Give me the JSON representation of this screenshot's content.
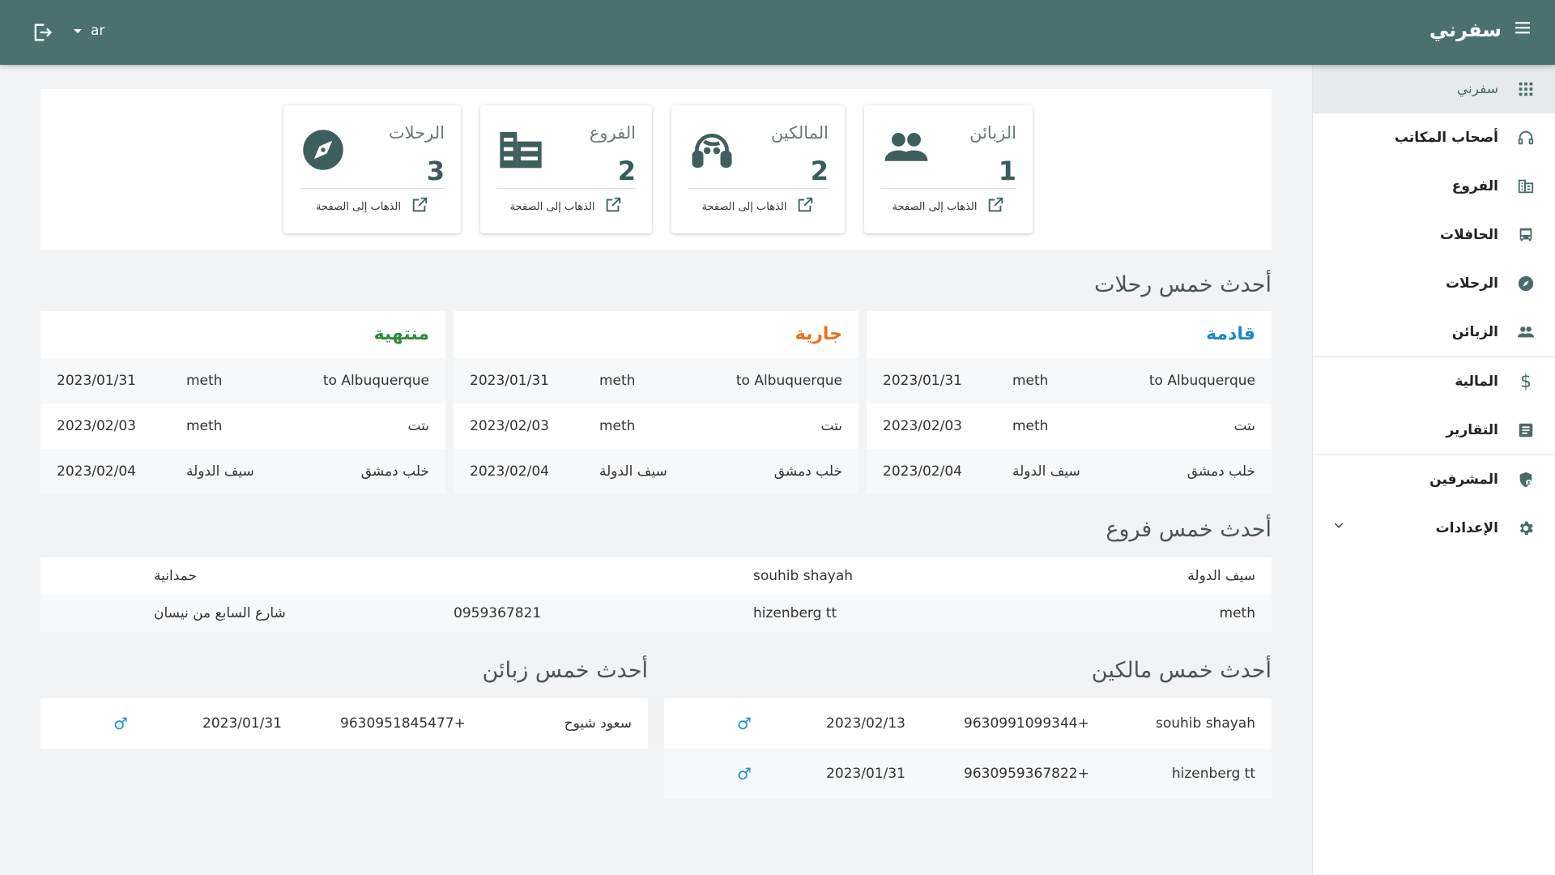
{
  "header": {
    "brand": "سفرني",
    "lang": "ar"
  },
  "sidebar": {
    "items": [
      {
        "label": "سفرني"
      },
      {
        "label": "أصحاب المكاتب"
      },
      {
        "label": "الفروع"
      },
      {
        "label": "الحافلات"
      },
      {
        "label": "الرحلات"
      },
      {
        "label": "الزبائن"
      },
      {
        "label": "المالية"
      },
      {
        "label": "التقارير"
      },
      {
        "label": "المشرفين"
      },
      {
        "label": "الإعدادات"
      }
    ]
  },
  "stats": [
    {
      "label": "الزبائن",
      "value": "1",
      "link": "الذهاب إلى الصفحة",
      "icon": "people-icon"
    },
    {
      "label": "المالكين",
      "value": "2",
      "link": "الذهاب إلى الصفحة",
      "icon": "headset-icon"
    },
    {
      "label": "الفروع",
      "value": "2",
      "link": "الذهاب إلى الصفحة",
      "icon": "building-icon"
    },
    {
      "label": "الرحلات",
      "value": "3",
      "link": "الذهاب إلى الصفحة",
      "icon": "compass-icon"
    }
  ],
  "trips_section": {
    "title": "أحدث خمس رحلات",
    "cards": [
      {
        "title": "قادمة",
        "color": "#1e88c8",
        "rows": [
          [
            "to Albuquerque",
            "meth",
            "2023/01/31"
          ],
          [
            "ىتت",
            "meth",
            "2023/02/03"
          ],
          [
            "خلب دمشق",
            "سيف الدولة",
            "2023/02/04"
          ]
        ]
      },
      {
        "title": "جارية",
        "color": "#e8701a",
        "rows": [
          [
            "to Albuquerque",
            "meth",
            "2023/01/31"
          ],
          [
            "ىتت",
            "meth",
            "2023/02/03"
          ],
          [
            "خلب دمشق",
            "سيف الدولة",
            "2023/02/04"
          ]
        ]
      },
      {
        "title": "منتهية",
        "color": "#2e8b3a",
        "rows": [
          [
            "to Albuquerque",
            "meth",
            "2023/01/31"
          ],
          [
            "ىتت",
            "meth",
            "2023/02/03"
          ],
          [
            "خلب دمشق",
            "سيف الدولة",
            "2023/02/04"
          ]
        ]
      }
    ]
  },
  "branches_section": {
    "title": "أحدث خمس فروع",
    "rows": [
      [
        "سيف الدولة",
        "souhib shayah",
        "",
        "حمدانية"
      ],
      [
        "meth",
        "hizenberg tt",
        "0959367821",
        "شارع السابع من نيسان"
      ]
    ]
  },
  "owners_section": {
    "title": "أحدث خمس مالكين",
    "rows": [
      [
        "souhib shayah",
        "+9630991099344",
        "2023/02/13",
        "♂"
      ],
      [
        "hizenberg tt",
        "+9630959367822",
        "2023/01/31",
        "♂"
      ]
    ]
  },
  "customers_section": {
    "title": "أحدث خمس زبائن",
    "rows": [
      [
        "سعود شيوح",
        "+9630951845477",
        "2023/01/31",
        "♂"
      ]
    ]
  }
}
